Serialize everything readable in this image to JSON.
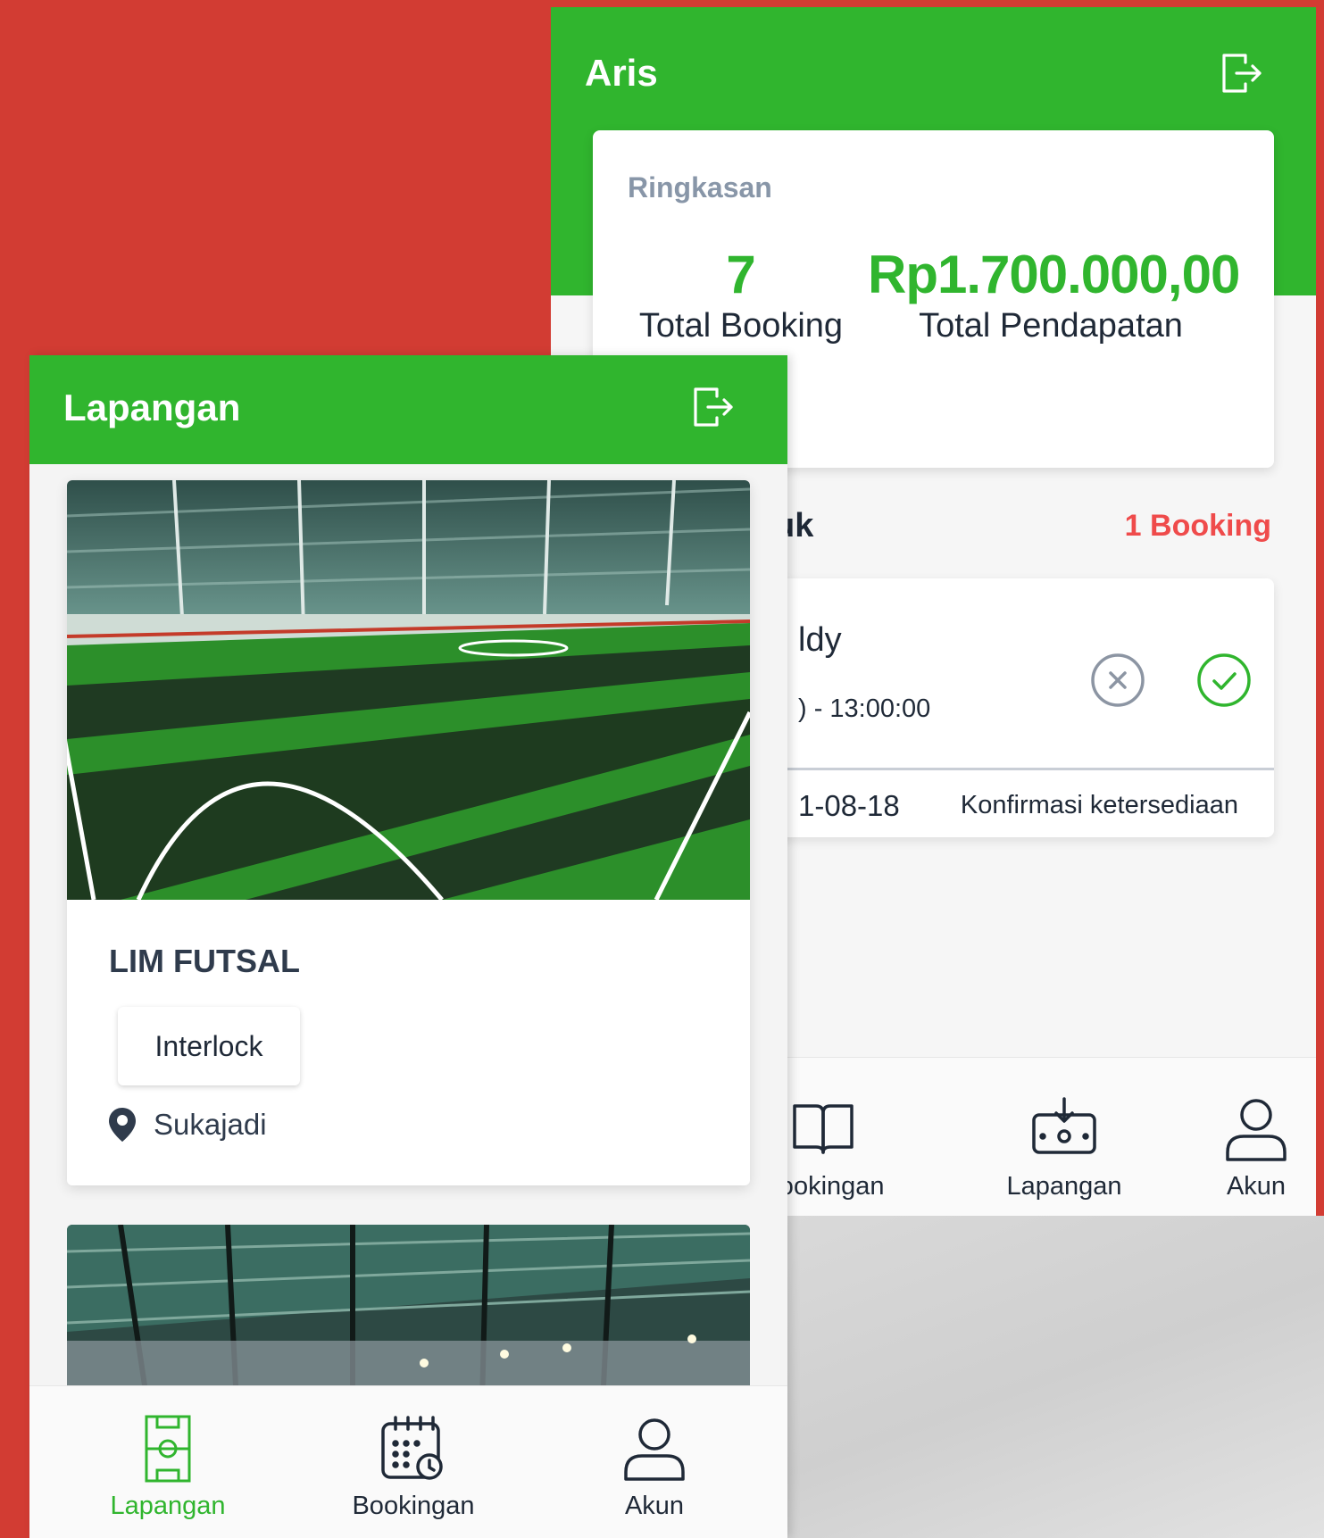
{
  "back_screen": {
    "title": "Aris",
    "summary": {
      "label": "Ringkasan",
      "total_booking_value": "7",
      "total_booking_label": "Total Booking",
      "total_income_value": "Rp1.700.000,00",
      "total_income_label": "Total Pendapatan"
    },
    "incoming": {
      "title_partial": "uk",
      "count": "1 Booking"
    },
    "booking": {
      "name_partial": "ldy",
      "time_partial": ") - 13:00:00",
      "date_partial": "1-08-18",
      "status": "Konfirmasi ketersediaan"
    },
    "nav": {
      "booking_label": "Bookingan",
      "lapangan_label": "Lapangan",
      "akun_label": "Akun"
    }
  },
  "front_screen": {
    "title": "Lapangan",
    "fields": [
      {
        "name": "LIM FUTSAL",
        "type": "Interlock",
        "location": "Sukajadi"
      }
    ],
    "nav": {
      "lapangan_label": "Lapangan",
      "booking_label": "Bookingan",
      "akun_label": "Akun",
      "active": "Lapangan"
    }
  },
  "colors": {
    "brand_green": "#30b52e",
    "background_red": "#d23c33",
    "alert_red": "#ef4b4b",
    "text_dark": "#1f2937",
    "muted": "#8896a8"
  },
  "icons": [
    "logout-icon",
    "reject-circle-icon",
    "accept-circle-icon",
    "book-icon",
    "field-download-icon",
    "user-icon",
    "soccer-field-icon",
    "calendar-clock-icon",
    "location-pin-icon"
  ]
}
